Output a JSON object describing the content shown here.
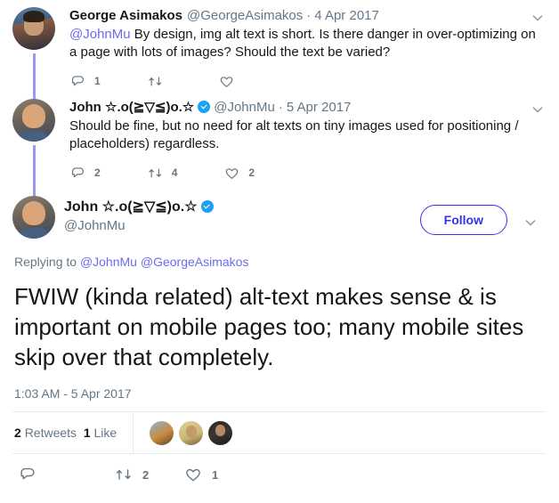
{
  "colors": {
    "link": "#6b6bf0",
    "follow_accent": "#3333ee",
    "thread_line": "#9999f5",
    "verified_badge": "#1da1f2",
    "muted_text": "#657786",
    "icon": "#66757f",
    "primary_text": "#14171a",
    "divider": "#e6ecf0"
  },
  "thread": {
    "tweets": [
      {
        "avatar": "george-asimakos-avatar",
        "display_name": "George Asimakos",
        "verified": false,
        "handle": "@GeorgeAsimakos",
        "separator": "·",
        "date": "4 Apr 2017",
        "text_mention": "@JohnMu",
        "text_body": " By design, img alt text is short. Is there danger in over-optimizing on a page with lots of images? Should the text be varied?",
        "actions": {
          "reply_count": "1",
          "retweet_count": "",
          "like_count": ""
        },
        "caret": "chevron-down-icon"
      },
      {
        "avatar": "john-mu-avatar",
        "display_name": "John ☆.o(≧▽≦)o.☆",
        "verified": true,
        "handle": "@JohnMu",
        "separator": "·",
        "date": "5 Apr 2017",
        "text_mention": "",
        "text_body": "Should be fine, but no need for alt texts on tiny images used for positioning / placeholders) regardless.",
        "actions": {
          "reply_count": "2",
          "retweet_count": "4",
          "like_count": "2"
        },
        "caret": "chevron-down-icon"
      }
    ]
  },
  "focal_tweet": {
    "avatar": "john-mu-avatar",
    "display_name": "John ☆.o(≧▽≦)o.☆",
    "verified": true,
    "handle": "@JohnMu",
    "follow_button_label": "Follow",
    "caret": "chevron-down-icon",
    "replying_to_prefix": "Replying to ",
    "replying_to_mentions": [
      "@JohnMu",
      "@GeorgeAsimakos"
    ],
    "text": "FWIW (kinda related) alt-text makes sense & is important on mobile pages too; many mobile sites skip over that completely.",
    "timestamp": "1:03 AM - 5 Apr 2017",
    "stats": {
      "retweet_number": "2",
      "retweet_label": "Retweets",
      "like_number": "1",
      "like_label": "Like"
    },
    "facepile": [
      "liker-avatar-1",
      "liker-avatar-2",
      "liker-avatar-3"
    ],
    "actions": {
      "reply_icon": "reply-icon",
      "reply_count": "",
      "retweet_icon": "retweet-icon",
      "retweet_count": "2",
      "like_icon": "like-icon",
      "like_count": "1"
    }
  }
}
